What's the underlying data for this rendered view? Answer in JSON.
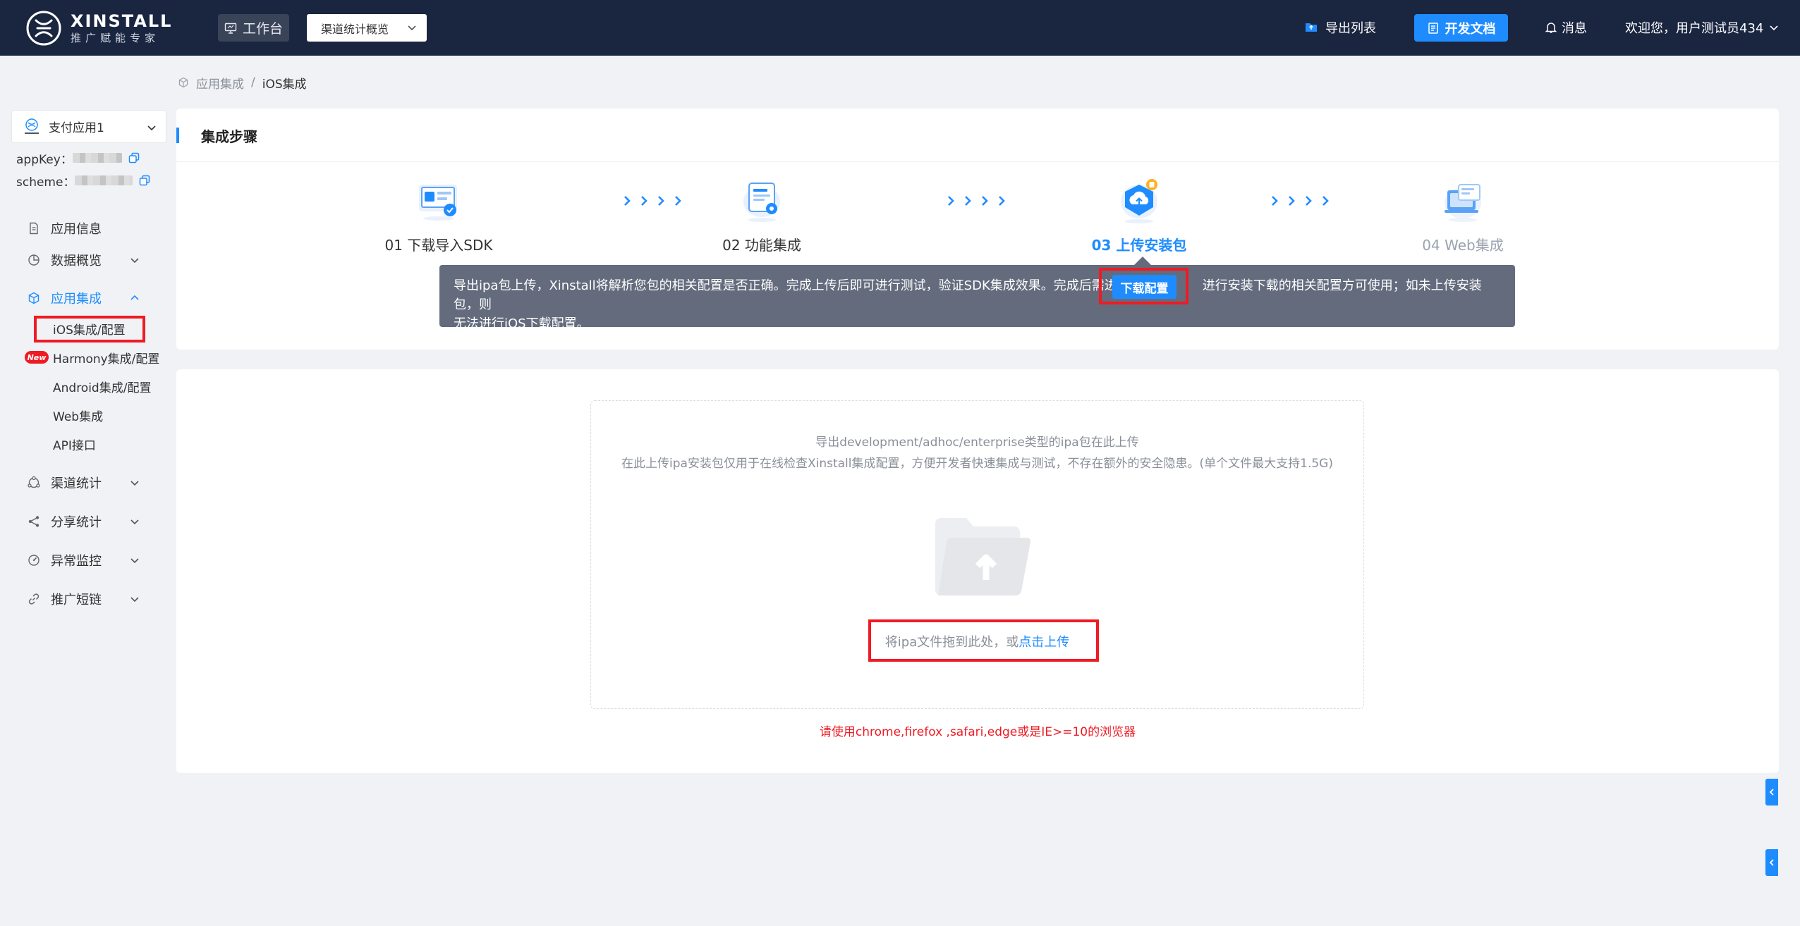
{
  "brand": {
    "name": "XINSTALL",
    "tagline": "推广赋能专家"
  },
  "topbar": {
    "workbench_label": "工作台",
    "nav_select_value": "渠道统计概览",
    "export_list_label": "导出列表",
    "dev_docs_label": "开发文档",
    "messages_label": "消息",
    "welcome_text": "欢迎您，用户测试员434"
  },
  "sidebar": {
    "app_select_value": "支付应用1",
    "appkey_label": "appKey：",
    "scheme_label": "scheme：",
    "menu": {
      "app_info": "应用信息",
      "data_overview": "数据概览",
      "app_integration": "应用集成",
      "channel_stats": "渠道统计",
      "share_stats": "分享统计",
      "anomaly_monitor": "异常监控",
      "short_links": "推广短链"
    },
    "submenu": {
      "ios": "iOS集成/配置",
      "harmony": "Harmony集成/配置",
      "android": "Android集成/配置",
      "web": "Web集成",
      "api": "API接口"
    },
    "new_badge": "New"
  },
  "breadcrumb": {
    "parent": "应用集成",
    "separator": "/",
    "current": "iOS集成"
  },
  "steps_card": {
    "title": "集成步骤",
    "steps": [
      {
        "label": "01 下载导入SDK",
        "state": "done"
      },
      {
        "label": "02 功能集成",
        "state": "done"
      },
      {
        "label": "03 上传安装包",
        "state": "current"
      },
      {
        "label": "04 Web集成",
        "state": "future"
      }
    ],
    "tip_part1": "导出ipa包上传，Xinstall将解析您包的相关配置是否正确。完成上传后即可进行测试，验证SDK集成效果。完成后需进入",
    "tip_button": "下载配置",
    "tip_part2": "进行安装下载的相关配置方可使用；如未上传安装包，则",
    "tip_part3": "无法进行iOS下载配置。"
  },
  "upload": {
    "line1": "导出development/adhoc/enterprise类型的ipa包在此上传",
    "line2": "在此上传ipa安装包仅用于在线检查Xinstall集成配置，方便开发者快速集成与测试，不存在额外的安全隐患。(单个文件最大支持1.5G)",
    "drop_text": "将ipa文件拖到此处，或",
    "click_upload": "点击上传",
    "browser_note": "请使用chrome,firefox ,safari,edge或是IE>=10的浏览器"
  },
  "colors": {
    "topbar_bg": "#1a2540",
    "accent": "#1e8cff",
    "highlight_red": "#ee1b24",
    "tip_bg": "#636b7d",
    "page_bg": "#f0f2f5"
  }
}
